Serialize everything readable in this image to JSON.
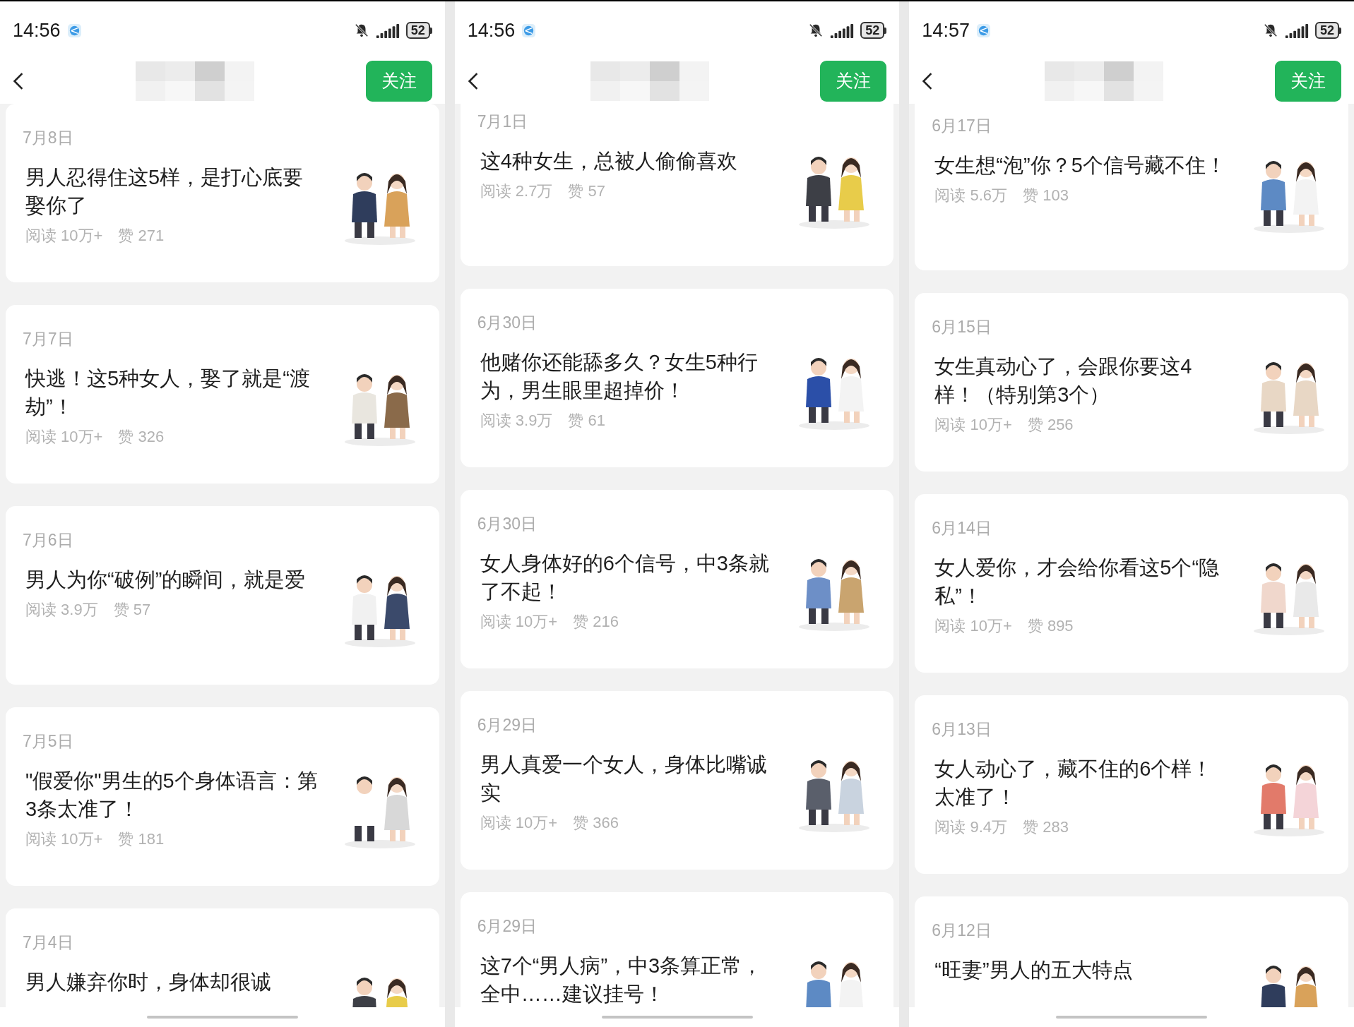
{
  "panels": [
    {
      "status_bar": {
        "time": "14:56",
        "battery": "52"
      },
      "follow_button": "关注",
      "articles": [
        {
          "date": "7月8日",
          "title": "男人忍得住这5样，是打心底要娶你了",
          "reads": "阅读 10万+",
          "likes": "赞 271"
        },
        {
          "date": "7月7日",
          "title": "快逃！这5种女人，娶了就是“渡劫”！",
          "reads": "阅读 10万+",
          "likes": "赞 326"
        },
        {
          "date": "7月6日",
          "title": "男人为你“破例”的瞬间，就是爱",
          "reads": "阅读 3.9万",
          "likes": "赞 57"
        },
        {
          "date": "7月5日",
          "title": "\"假爱你\"男生的5个身体语言：第3条太准了！",
          "reads": "阅读 10万+",
          "likes": "赞 181"
        },
        {
          "date": "7月4日",
          "title": "男人嫌弃你时，身体却很诚"
        }
      ]
    },
    {
      "status_bar": {
        "time": "14:56",
        "battery": "52"
      },
      "follow_button": "关注",
      "articles": [
        {
          "date": "7月1日",
          "title": "这4种女生，总被人偷偷喜欢",
          "reads": "阅读 2.7万",
          "likes": "赞 57"
        },
        {
          "date": "6月30日",
          "title": "他赌你还能舔多久？女生5种行为，男生眼里超掉价！",
          "reads": "阅读 3.9万",
          "likes": "赞 61"
        },
        {
          "date": "6月30日",
          "title": "女人身体好的6个信号，中3条就了不起！",
          "reads": "阅读 10万+",
          "likes": "赞 216"
        },
        {
          "date": "6月29日",
          "title": "男人真爱一个女人，身体比嘴诚实",
          "reads": "阅读 10万+",
          "likes": "赞 366"
        },
        {
          "date": "6月29日",
          "title": "这7个“男人病”，中3条算正常，全中……建议挂号！"
        }
      ]
    },
    {
      "status_bar": {
        "time": "14:57",
        "battery": "52"
      },
      "follow_button": "关注",
      "articles": [
        {
          "date": "6月17日",
          "title": "女生想“泡”你？5个信号藏不住！",
          "reads": "阅读 5.6万",
          "likes": "赞 103"
        },
        {
          "date": "6月15日",
          "title": "女生真动心了，会跟你要这4样！（特别第3个）",
          "reads": "阅读 10万+",
          "likes": "赞 256"
        },
        {
          "date": "6月14日",
          "title": "女人爱你，才会给你看这5个“隐私”！",
          "reads": "阅读 10万+",
          "likes": "赞 895"
        },
        {
          "date": "6月13日",
          "title": "女人动心了，藏不住的6个样！太准了！",
          "reads": "阅读 9.4万",
          "likes": "赞 283"
        },
        {
          "date": "6月12日",
          "title": "“旺妻”男人的五大特点"
        }
      ]
    }
  ]
}
